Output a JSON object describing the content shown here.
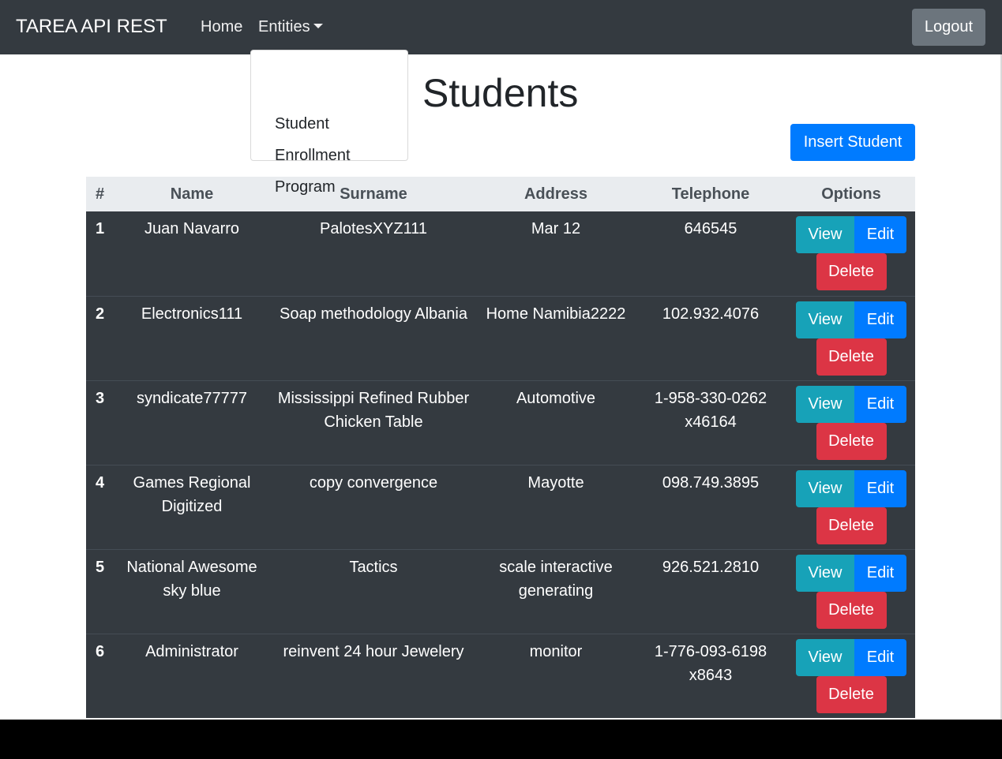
{
  "navbar": {
    "brand": "TAREA API REST",
    "home": "Home",
    "entities": "Entities",
    "logout": "Logout"
  },
  "dropdown": {
    "items": [
      "Student",
      "Enrollment",
      "Program"
    ]
  },
  "page": {
    "title": "Students",
    "insert_button": "Insert Student"
  },
  "table": {
    "headers": [
      "#",
      "Name",
      "Surname",
      "Address",
      "Telephone",
      "Options"
    ],
    "buttons": {
      "view": "View",
      "edit": "Edit",
      "delete": "Delete"
    },
    "rows": [
      {
        "num": "1",
        "name": "Juan Navarro",
        "surname": "PalotesXYZ111",
        "address": "Mar 12",
        "telephone": "646545"
      },
      {
        "num": "2",
        "name": "Electronics111",
        "surname": "Soap methodology Albania",
        "address": "Home Namibia2222",
        "telephone": "102.932.4076"
      },
      {
        "num": "3",
        "name": "syndicate77777",
        "surname": "Mississippi Refined Rubber Chicken Table",
        "address": "Automotive",
        "telephone": "1-958-330-0262 x46164"
      },
      {
        "num": "4",
        "name": "Games Regional Digitized",
        "surname": "copy convergence",
        "address": "Mayotte",
        "telephone": "098.749.3895"
      },
      {
        "num": "5",
        "name": "National Awesome sky blue",
        "surname": "Tactics",
        "address": "scale interactive generating",
        "telephone": "926.521.2810"
      },
      {
        "num": "6",
        "name": "Administrator",
        "surname": "reinvent 24 hour Jewelery",
        "address": "monitor",
        "telephone": "1-776-093-6198 x8643"
      }
    ]
  },
  "colors": {
    "navbar": "#343a40",
    "primary": "#007bff",
    "info": "#17a2b8",
    "danger": "#dc3545",
    "secondary": "#6c757d"
  }
}
